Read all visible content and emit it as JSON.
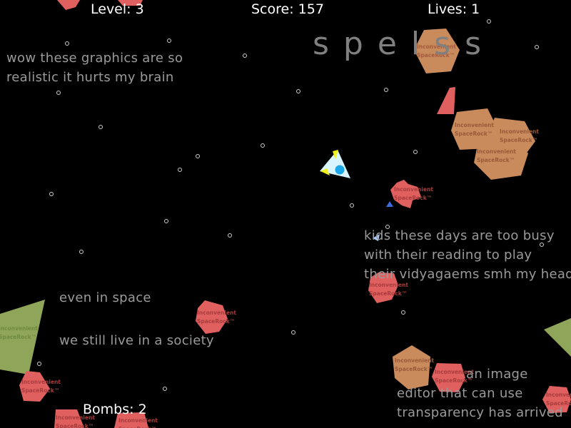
{
  "hud": {
    "level": "Level: 3",
    "score": "Score: 157",
    "lives": "Lives: 1",
    "bombs": "Bombs: 2"
  },
  "title": "spelss",
  "messages": {
    "graphics": "wow these graphics are so\nrealistic it hurts my brain",
    "kids": "kids these days are too busy\nwith their reading to play\ntheir vidyagaems smh my head",
    "space": "even in space",
    "society": "we still live in a society",
    "editor_partial": "an image\neditor that can use\ntransparency has arrived"
  },
  "rock_label": {
    "line1": "Inconvenient",
    "line2": "SpaceRock™"
  },
  "colors": {
    "background": "#000000",
    "rock_red": "#e06060",
    "rock_brown": "#c98a5c",
    "rock_green": "#8fa65a",
    "ship_body": "#d8f4ff",
    "ship_core": "#1aa8e8",
    "ship_flame": "#f2f21a",
    "hud_text": "#ffffff",
    "message_text": "#9a9a9a"
  },
  "icons": [
    "player-ship-icon",
    "asteroid-icon",
    "star-icon",
    "bullet-icon"
  ]
}
